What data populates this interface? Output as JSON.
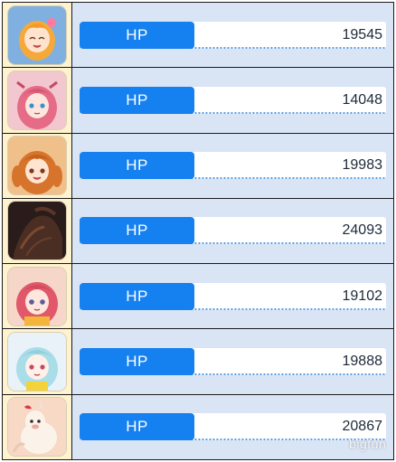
{
  "rows": [
    {
      "avatar": "orange-hair-girl-avatar",
      "label": "HP",
      "value": "19545"
    },
    {
      "avatar": "pink-hair-girl-avatar",
      "label": "HP",
      "value": "14048"
    },
    {
      "avatar": "orange-pigtail-girl-avatar",
      "label": "HP",
      "value": "19983"
    },
    {
      "avatar": "dark-creature-avatar",
      "label": "HP",
      "value": "24093"
    },
    {
      "avatar": "red-hair-girl-avatar",
      "label": "HP",
      "value": "19102"
    },
    {
      "avatar": "light-blue-hair-girl-avatar",
      "label": "HP",
      "value": "19888"
    },
    {
      "avatar": "alpaca-avatar",
      "label": "HP",
      "value": "20867"
    }
  ],
  "watermark": "bigfun",
  "colors": {
    "hp_label_bg": "#1580f0",
    "stat_row_bg": "#d9e4f5",
    "avatar_cell_bg": "#fff3cf",
    "bar_dotted_line": "#5b9be0"
  }
}
